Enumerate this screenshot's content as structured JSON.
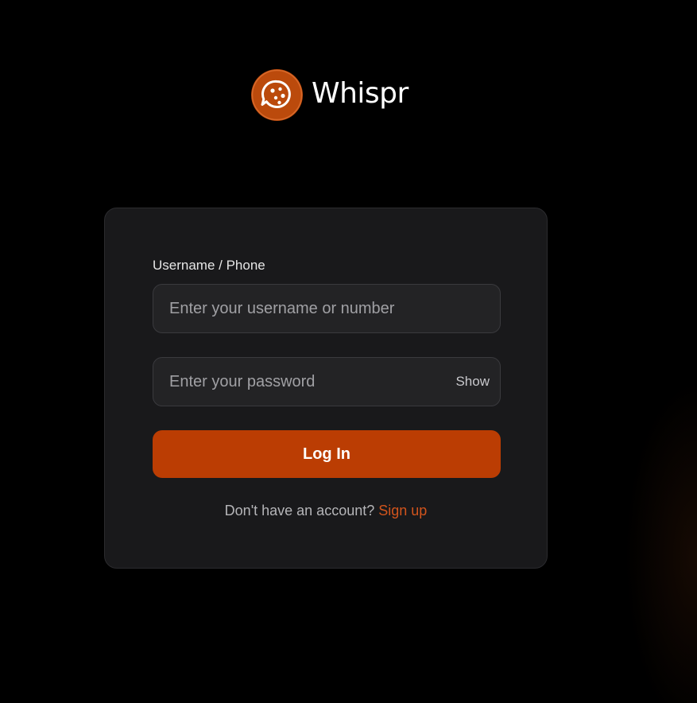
{
  "brand": {
    "name": "Whispr",
    "logo_icon": "chat-bubble-dots-icon",
    "accent_color": "#bb3d03"
  },
  "login_form": {
    "username_label": "Username / Phone",
    "username_placeholder": "Enter your username or number",
    "username_value": "",
    "password_placeholder": "Enter your password",
    "password_value": "",
    "show_password_label": "Show",
    "submit_label": "Log In",
    "signup_prompt": "Don't have an account?",
    "signup_link": "Sign up"
  }
}
